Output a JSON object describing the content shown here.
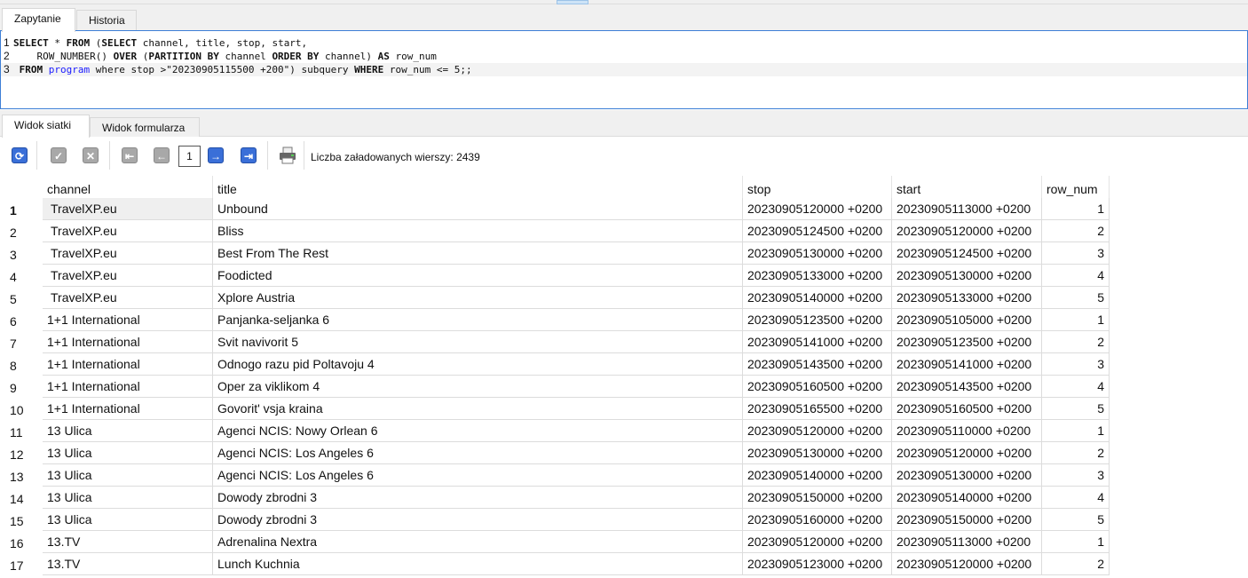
{
  "query_tabs": [
    "Zapytanie",
    "Historia"
  ],
  "sql": {
    "lines": [
      {
        "n": "1"
      },
      {
        "n": "2"
      },
      {
        "n": "3"
      }
    ]
  },
  "sql_tokens": {
    "l1a": "SELECT",
    "l1b": " * ",
    "l1c": "FROM",
    "l1d": " (",
    "l1e": "SELECT",
    "l1f": " channel, title, stop, start,",
    "l2a": "    ROW_NUMBER() ",
    "l2b": "OVER",
    "l2c": " (",
    "l2d": "PARTITION BY",
    "l2e": " channel ",
    "l2f": "ORDER BY",
    "l2g": " channel) ",
    "l2h": "AS",
    "l2i": " row_num",
    "l3a": " ",
    "l3b": "FROM",
    "l3c": " ",
    "l3d": "program",
    "l3e": " where stop >\"20230905115500 +200\") subquery ",
    "l3f": "WHERE",
    "l3g": " row_num <= 5;;"
  },
  "result_tabs": [
    "Widok siatki",
    "Widok formularza"
  ],
  "toolbar": {
    "page": "1",
    "count_label": "Liczba załadowanych wierszy: 2439"
  },
  "columns": [
    "channel",
    "title",
    "stop",
    "start",
    "row_num"
  ],
  "rows": [
    [
      "1",
      "TravelXP.eu",
      "Unbound",
      "20230905120000 +0200",
      "20230905113000 +0200",
      "1"
    ],
    [
      "2",
      "TravelXP.eu",
      "Bliss",
      "20230905124500 +0200",
      "20230905120000 +0200",
      "2"
    ],
    [
      "3",
      "TravelXP.eu",
      "Best From The Rest",
      "20230905130000 +0200",
      "20230905124500 +0200",
      "3"
    ],
    [
      "4",
      "TravelXP.eu",
      "Foodicted",
      "20230905133000 +0200",
      "20230905130000 +0200",
      "4"
    ],
    [
      "5",
      "TravelXP.eu",
      "Xplore Austria",
      "20230905140000 +0200",
      "20230905133000 +0200",
      "5"
    ],
    [
      "6",
      "1+1 International",
      "Panjanka-seljanka 6",
      "20230905123500 +0200",
      "20230905105000 +0200",
      "1"
    ],
    [
      "7",
      "1+1 International",
      "Svit navivorit 5",
      "20230905141000 +0200",
      "20230905123500 +0200",
      "2"
    ],
    [
      "8",
      "1+1 International",
      "Odnogo razu pid Poltavoju 4",
      "20230905143500 +0200",
      "20230905141000 +0200",
      "3"
    ],
    [
      "9",
      "1+1 International",
      "Oper za viklikom 4",
      "20230905160500 +0200",
      "20230905143500 +0200",
      "4"
    ],
    [
      "10",
      "1+1 International",
      "Govorit' vsja kraina",
      "20230905165500 +0200",
      "20230905160500 +0200",
      "5"
    ],
    [
      "11",
      "13 Ulica",
      "Agenci NCIS: Nowy Orlean 6",
      "20230905120000 +0200",
      "20230905110000 +0200",
      "1"
    ],
    [
      "12",
      "13 Ulica",
      "Agenci NCIS: Los Angeles 6",
      "20230905130000 +0200",
      "20230905120000 +0200",
      "2"
    ],
    [
      "13",
      "13 Ulica",
      "Agenci NCIS: Los Angeles 6",
      "20230905140000 +0200",
      "20230905130000 +0200",
      "3"
    ],
    [
      "14",
      "13 Ulica",
      "Dowody zbrodni 3",
      "20230905150000 +0200",
      "20230905140000 +0200",
      "4"
    ],
    [
      "15",
      "13 Ulica",
      "Dowody zbrodni 3",
      "20230905160000 +0200",
      "20230905150000 +0200",
      "5"
    ],
    [
      "16",
      "13.TV",
      "Adrenalina Nextra",
      "20230905120000 +0200",
      "20230905113000 +0200",
      "1"
    ],
    [
      "17",
      "13.TV",
      "Lunch Kuchnia",
      "20230905123000 +0200",
      "20230905120000 +0200",
      "2"
    ]
  ]
}
